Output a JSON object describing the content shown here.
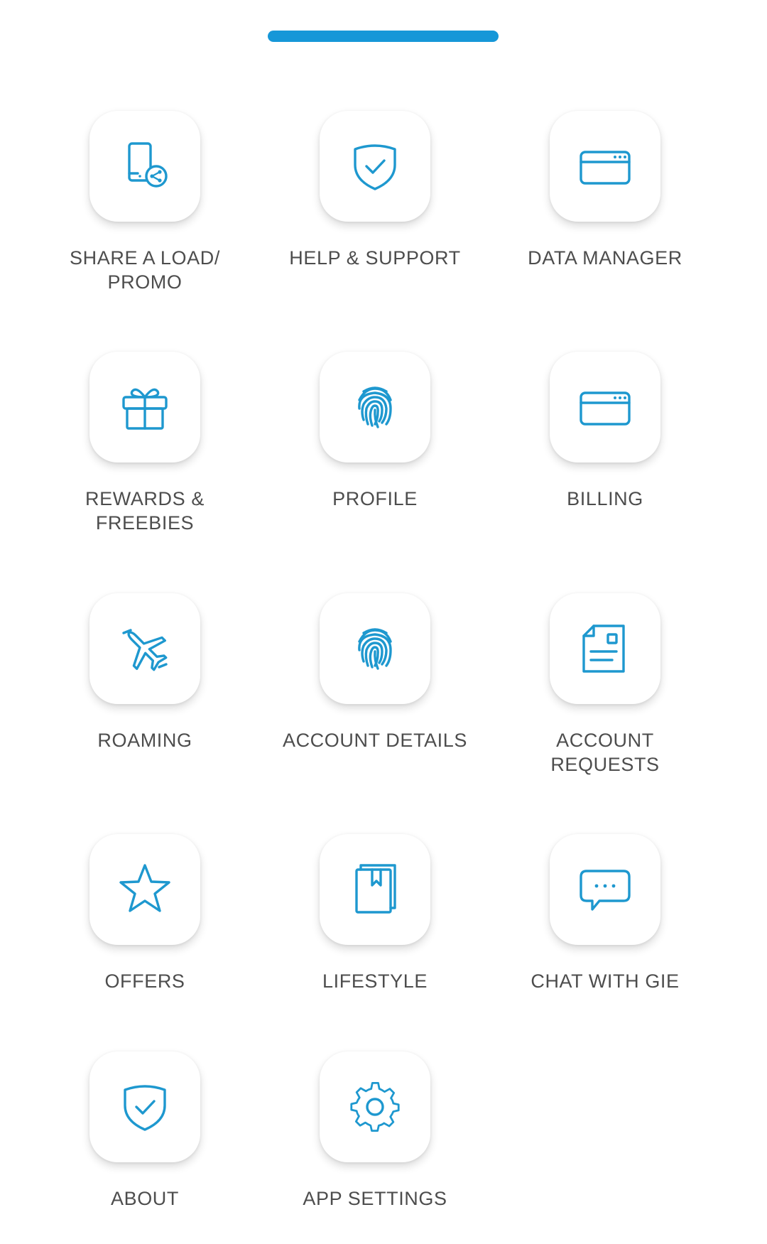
{
  "accent_color": "#1e98cf",
  "handle_color": "#1697d8",
  "menu": {
    "items": [
      {
        "label": "SHARE A LOAD/\nPROMO",
        "icon": "share-load-icon"
      },
      {
        "label": "HELP & SUPPORT",
        "icon": "shield-check-icon"
      },
      {
        "label": "DATA MANAGER",
        "icon": "browser-card-icon"
      },
      {
        "label": "REWARDS &\nFREEBIES",
        "icon": "gift-icon"
      },
      {
        "label": "PROFILE",
        "icon": "fingerprint-icon"
      },
      {
        "label": "BILLING",
        "icon": "browser-card-icon"
      },
      {
        "label": "ROAMING",
        "icon": "airplane-icon"
      },
      {
        "label": "ACCOUNT DETAILS",
        "icon": "fingerprint-icon"
      },
      {
        "label": "ACCOUNT\nREQUESTS",
        "icon": "document-icon"
      },
      {
        "label": "OFFERS",
        "icon": "star-icon"
      },
      {
        "label": "LIFESTYLE",
        "icon": "book-icon"
      },
      {
        "label": "CHAT WITH GIE",
        "icon": "chat-bubble-icon"
      },
      {
        "label": "ABOUT",
        "icon": "shield-check-icon"
      },
      {
        "label": "APP SETTINGS",
        "icon": "gear-icon"
      }
    ]
  }
}
